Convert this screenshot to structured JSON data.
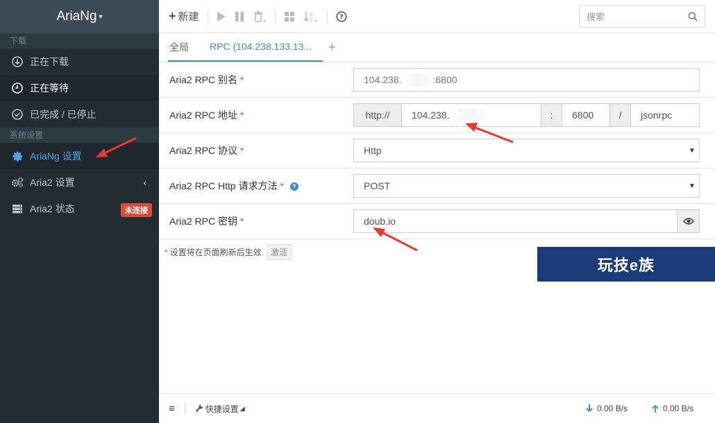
{
  "sidebar": {
    "brand": "AriaNg",
    "section_download": "下载",
    "items_download": [
      {
        "label": "正在下载",
        "icon": "download-circle-icon"
      },
      {
        "label": "正在等待",
        "icon": "clock-icon"
      },
      {
        "label": "已完成 / 已停止",
        "icon": "check-circle-icon"
      }
    ],
    "section_settings": "系统设置",
    "items_settings": [
      {
        "label": "AriaNg 设置",
        "icon": "gear-icon"
      },
      {
        "label": "Aria2 设置",
        "icon": "gears-icon"
      },
      {
        "label": "Aria2 状态",
        "icon": "server-icon",
        "badge": "未连接"
      }
    ]
  },
  "toolbar": {
    "new_label": "新建",
    "search_placeholder": "搜索"
  },
  "tabs": {
    "global": "全局",
    "rpc": "RPC (104.238.133.13...",
    "add": "+"
  },
  "form": {
    "alias_label": "Aria2 RPC 别名",
    "alias_value_prefix": "104.238.",
    "alias_value_suffix": ":6800",
    "address_label": "Aria2 RPC 地址",
    "address_protocol": "http://",
    "address_host": "104.238.",
    "address_colon": ":",
    "address_port": "6800",
    "address_slash": "/",
    "address_path": "jsonrpc",
    "protocol_label": "Aria2 RPC 协议",
    "protocol_value": "Http",
    "method_label": "Aria2 RPC Http 请求方法",
    "method_value": "POST",
    "secret_label": "Aria2 RPC 密钥",
    "secret_value": "doub.io",
    "required_mark": "*"
  },
  "note": {
    "star": "*",
    "text": "设置将在页面刷新后生效.",
    "button": "激活"
  },
  "watermark": "玩技e族",
  "footer": {
    "quick_settings": "快捷设置",
    "download_speed": "0.00 B/s",
    "upload_speed": "0.00 B/s"
  },
  "colors": {
    "sidebar_bg": "#222d32",
    "accent": "#3c8dbc",
    "annotation_arrow": "#e8382f",
    "badge": "#dd4b39"
  }
}
